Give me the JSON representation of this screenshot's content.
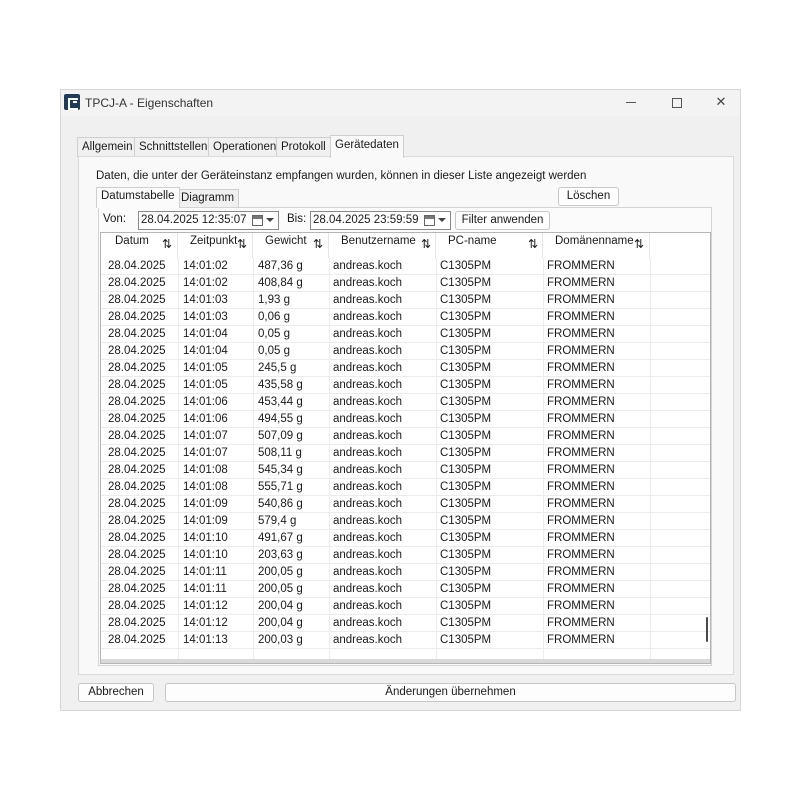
{
  "window": {
    "title": "TPCJ-A - Eigenschaften",
    "controls": {
      "minimize": "",
      "maximize": "",
      "close": "✕"
    }
  },
  "tabs": [
    {
      "label": "Allgemein",
      "active": false
    },
    {
      "label": "Schnittstellen",
      "active": false
    },
    {
      "label": "Operationen",
      "active": false
    },
    {
      "label": "Protokoll",
      "active": false
    },
    {
      "label": "Gerätedaten",
      "active": true
    }
  ],
  "geraetedaten": {
    "description": "Daten, die unter der Geräteinstanz empfangen wurden, können in dieser Liste angezeigt werden",
    "delete_label": "Löschen",
    "subtabs": [
      {
        "label": "Datumstabelle",
        "active": true
      },
      {
        "label": "Diagramm",
        "active": false
      }
    ],
    "filter": {
      "from_label": "Von:",
      "from_value": "28.04.2025 12:35:07",
      "to_label": "Bis:",
      "to_value": "28.04.2025 23:59:59",
      "apply_label": "Filter anwenden"
    },
    "table": {
      "columns": [
        "Datum",
        "Zeitpunkt",
        "Gewicht",
        "Benutzername",
        "PC-name",
        "Domänenname"
      ],
      "sort_icon": "⇅",
      "rows": [
        [
          "28.04.2025",
          "14:01:02",
          "487,36 g",
          "andreas.koch",
          "C1305PM",
          "FROMMERN"
        ],
        [
          "28.04.2025",
          "14:01:02",
          "408,84 g",
          "andreas.koch",
          "C1305PM",
          "FROMMERN"
        ],
        [
          "28.04.2025",
          "14:01:03",
          "1,93 g",
          "andreas.koch",
          "C1305PM",
          "FROMMERN"
        ],
        [
          "28.04.2025",
          "14:01:03",
          "0,06 g",
          "andreas.koch",
          "C1305PM",
          "FROMMERN"
        ],
        [
          "28.04.2025",
          "14:01:04",
          "0,05 g",
          "andreas.koch",
          "C1305PM",
          "FROMMERN"
        ],
        [
          "28.04.2025",
          "14:01:04",
          "0,05 g",
          "andreas.koch",
          "C1305PM",
          "FROMMERN"
        ],
        [
          "28.04.2025",
          "14:01:05",
          "245,5 g",
          "andreas.koch",
          "C1305PM",
          "FROMMERN"
        ],
        [
          "28.04.2025",
          "14:01:05",
          "435,58 g",
          "andreas.koch",
          "C1305PM",
          "FROMMERN"
        ],
        [
          "28.04.2025",
          "14:01:06",
          "453,44 g",
          "andreas.koch",
          "C1305PM",
          "FROMMERN"
        ],
        [
          "28.04.2025",
          "14:01:06",
          "494,55 g",
          "andreas.koch",
          "C1305PM",
          "FROMMERN"
        ],
        [
          "28.04.2025",
          "14:01:07",
          "507,09 g",
          "andreas.koch",
          "C1305PM",
          "FROMMERN"
        ],
        [
          "28.04.2025",
          "14:01:07",
          "508,11 g",
          "andreas.koch",
          "C1305PM",
          "FROMMERN"
        ],
        [
          "28.04.2025",
          "14:01:08",
          "545,34 g",
          "andreas.koch",
          "C1305PM",
          "FROMMERN"
        ],
        [
          "28.04.2025",
          "14:01:08",
          "555,71 g",
          "andreas.koch",
          "C1305PM",
          "FROMMERN"
        ],
        [
          "28.04.2025",
          "14:01:09",
          "540,86 g",
          "andreas.koch",
          "C1305PM",
          "FROMMERN"
        ],
        [
          "28.04.2025",
          "14:01:09",
          "579,4 g",
          "andreas.koch",
          "C1305PM",
          "FROMMERN"
        ],
        [
          "28.04.2025",
          "14:01:10",
          "491,67 g",
          "andreas.koch",
          "C1305PM",
          "FROMMERN"
        ],
        [
          "28.04.2025",
          "14:01:10",
          "203,63 g",
          "andreas.koch",
          "C1305PM",
          "FROMMERN"
        ],
        [
          "28.04.2025",
          "14:01:11",
          "200,05 g",
          "andreas.koch",
          "C1305PM",
          "FROMMERN"
        ],
        [
          "28.04.2025",
          "14:01:11",
          "200,05 g",
          "andreas.koch",
          "C1305PM",
          "FROMMERN"
        ],
        [
          "28.04.2025",
          "14:01:12",
          "200,04 g",
          "andreas.koch",
          "C1305PM",
          "FROMMERN"
        ],
        [
          "28.04.2025",
          "14:01:12",
          "200,04 g",
          "andreas.koch",
          "C1305PM",
          "FROMMERN"
        ],
        [
          "28.04.2025",
          "14:01:13",
          "200,03 g",
          "andreas.koch",
          "C1305PM",
          "FROMMERN"
        ]
      ]
    }
  },
  "footer": {
    "cancel_label": "Abbrechen",
    "apply_label": "Änderungen übernehmen"
  },
  "colors": {
    "window_bg": "#f0f0f0",
    "page_bg": "#f9f9f9",
    "grid_bg": "#ffffff",
    "app_icon": "#1f3b57"
  }
}
